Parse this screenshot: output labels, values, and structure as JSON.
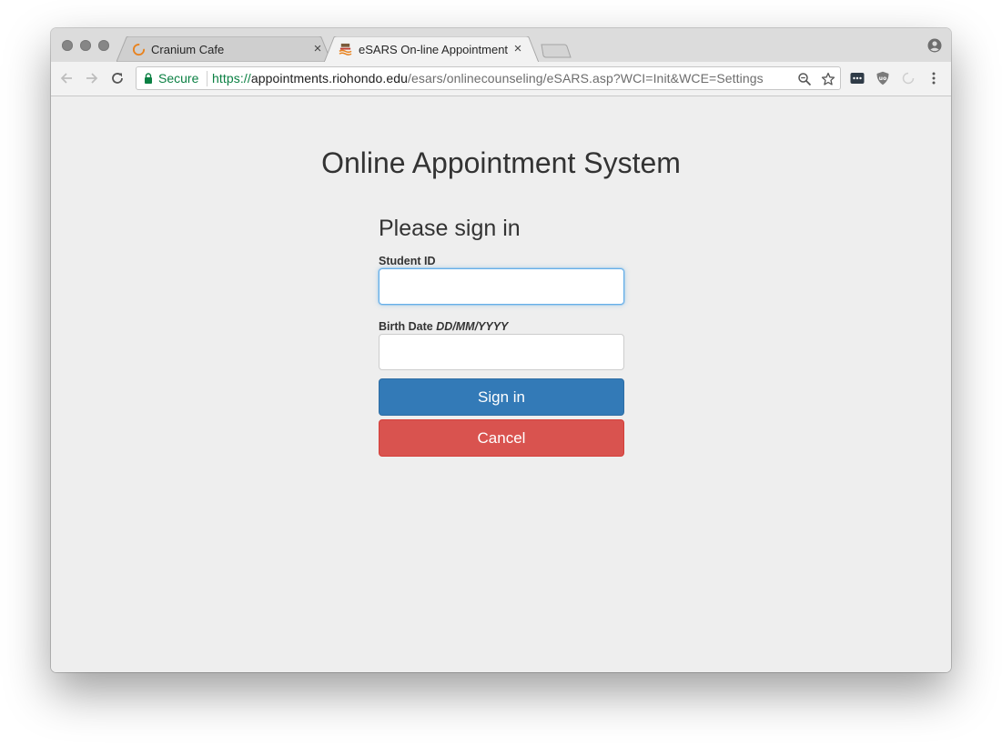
{
  "browser": {
    "tabs": [
      {
        "title": "Cranium Cafe",
        "favicon": "loading-spinner-icon",
        "active": false
      },
      {
        "title": "eSARS On-line Appointment System",
        "favicon": "school-logo-icon",
        "active": true
      }
    ],
    "address_bar": {
      "secure_label": "Secure",
      "url_scheme": "https://",
      "url_host": "appointments.riohondo.edu",
      "url_path": "/esars/onlinecounseling/eSARS.asp?WCI=Init&WCE=Settings"
    },
    "colors": {
      "secure_green": "#0b8043",
      "spinner_orange": "#e8821e"
    }
  },
  "page": {
    "title": "Online Appointment System",
    "form": {
      "heading": "Please sign in",
      "student_id_label": "Student ID",
      "student_id_value": "",
      "birth_date_label": "Birth Date",
      "birth_date_format": "DD/MM/YYYY",
      "birth_date_value": "",
      "sign_in_label": "Sign in",
      "cancel_label": "Cancel"
    },
    "colors": {
      "primary_button": "#337ab7",
      "danger_button": "#d9534f",
      "focus_border": "#66afe9"
    }
  }
}
